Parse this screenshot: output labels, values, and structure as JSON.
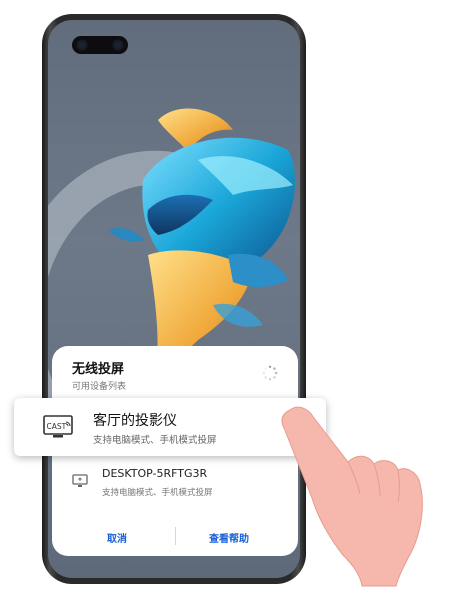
{
  "dialog": {
    "title": "无线投屏",
    "subtitle": "可用设备列表"
  },
  "devices": [
    {
      "name": "客厅的投影仪",
      "description": "支持电脑模式、手机模式投屏",
      "icon": "projector-cast-icon",
      "highlighted": true
    },
    {
      "name": "DESKTOP-5RFTG3R",
      "description": "支持电脑模式、手机模式投屏",
      "icon": "computer-monitor-icon",
      "highlighted": false
    }
  ],
  "buttons": {
    "cancel": "取消",
    "help": "查看帮助"
  },
  "cast_icon_text": "CAST",
  "colors": {
    "accent": "#1760d8",
    "hand": "#f6b8ad"
  }
}
